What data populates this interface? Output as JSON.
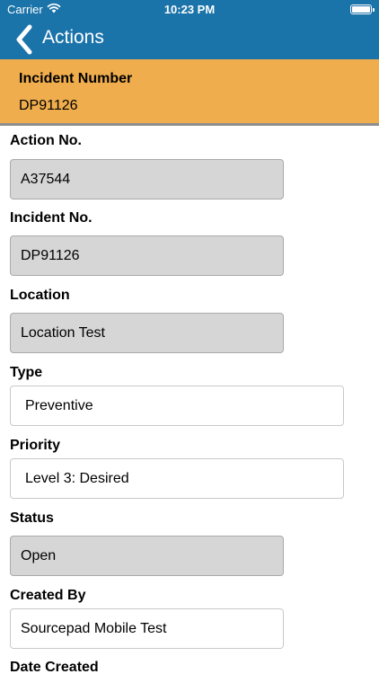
{
  "status_bar": {
    "carrier": "Carrier",
    "time": "10:23 PM"
  },
  "nav": {
    "title": "Actions"
  },
  "banner": {
    "label": "Incident Number",
    "value": "DP91126"
  },
  "fields": {
    "action_no": {
      "label": "Action No.",
      "value": "A37544"
    },
    "incident_no": {
      "label": "Incident No.",
      "value": "DP91126"
    },
    "location": {
      "label": "Location",
      "value": "Location Test"
    },
    "type": {
      "label": "Type",
      "value": "Preventive"
    },
    "priority": {
      "label": "Priority",
      "value": "Level 3: Desired"
    },
    "status": {
      "label": "Status",
      "value": "Open"
    },
    "created_by": {
      "label": "Created By",
      "value": "Sourcepad Mobile Test"
    },
    "date_created": {
      "label": "Date Created"
    }
  },
  "colors": {
    "nav_bar": "#1a73a9",
    "banner": "#efad4d",
    "readonly_field": "#d6d6d6"
  },
  "icons": {
    "wifi": "wifi-icon",
    "battery": "battery-icon",
    "back": "chevron-left-icon"
  }
}
